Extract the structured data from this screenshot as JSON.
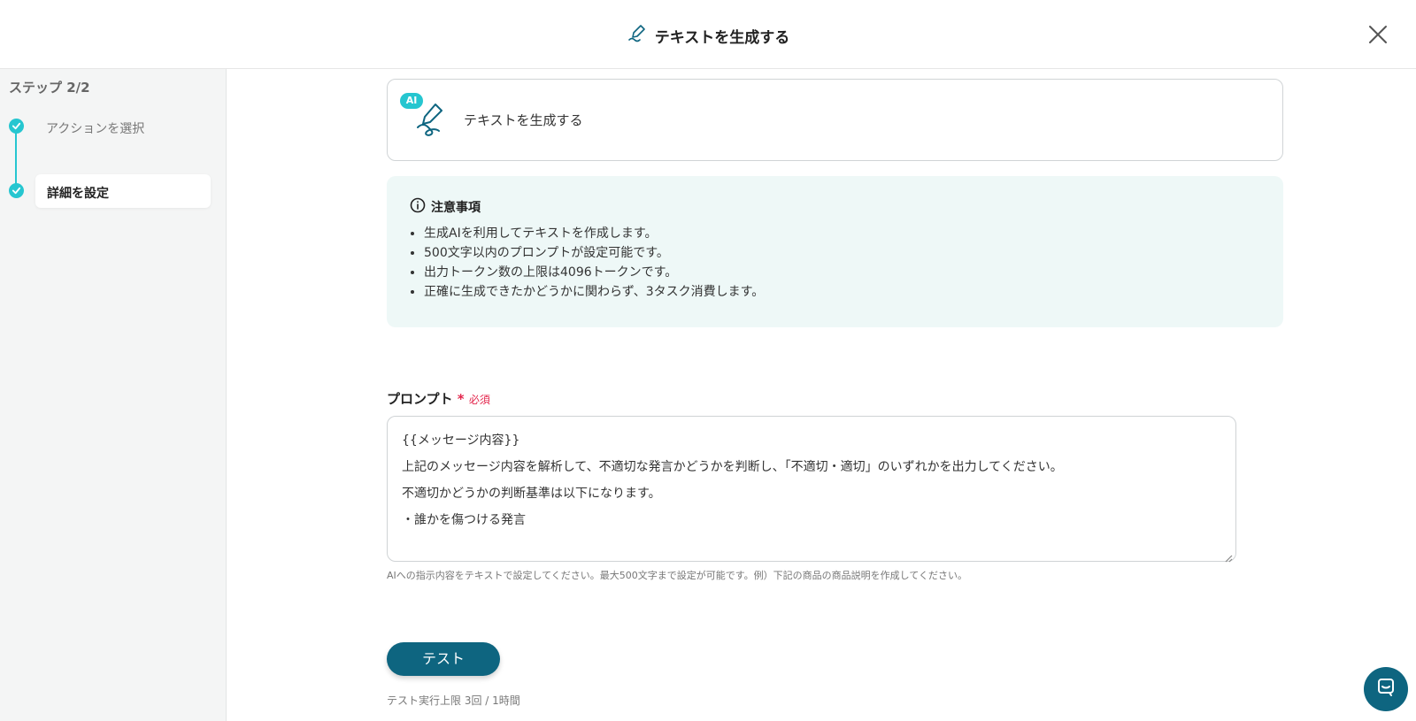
{
  "header": {
    "title": "テキストを生成する"
  },
  "sidebar": {
    "step_label": "ステップ 2/2",
    "steps": [
      {
        "label": "アクションを選択"
      },
      {
        "label": "詳細を設定"
      }
    ]
  },
  "action_card": {
    "badge": "AI",
    "label": "テキストを生成する"
  },
  "notice": {
    "title": "注意事項",
    "items": [
      "生成AIを利用してテキストを作成します。",
      "500文字以内のプロンプトが設定可能です。",
      "出力トークン数の上限は4096トークンです。",
      "正確に生成できたかどうかに関わらず、3タスク消費します。"
    ]
  },
  "prompt": {
    "label": "プロンプト",
    "required_mark": "*",
    "required_text": "必須",
    "lines": [
      "{{メッセージ内容}}",
      "上記のメッセージ内容を解析して、不適切な発言かどうかを判断し、「不適切・適切」のいずれかを出力してください。",
      "不適切かどうかの判断基準は以下になります。",
      "・誰かを傷つける発言"
    ],
    "hint": "AIへの指示内容をテキストで設定してください。最大500文字まで設定が可能です。例）下記の商品の商品説明を作成してください。"
  },
  "test": {
    "button_label": "テスト",
    "limit_text": "テスト実行上限 3回 / 1時間"
  },
  "colors": {
    "accent": "#26c6d0",
    "primary": "#0e6580",
    "required": "#e3264c",
    "notice_bg": "#eef8f7"
  }
}
